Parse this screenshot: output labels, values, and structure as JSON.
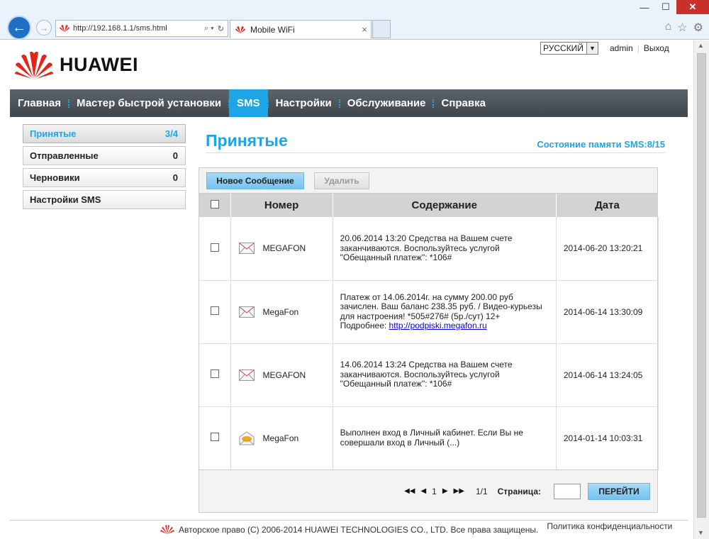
{
  "browser": {
    "url": "http://192.168.1.1/sms.html",
    "tab_title": "Mobile WiFi",
    "min_label": "—",
    "max_label": "☐",
    "close_label": "✕",
    "back_label": "←",
    "forward_label": "→"
  },
  "header": {
    "brand": "HUAWEI",
    "language": "РУССКИЙ",
    "user": "admin",
    "logout": "Выход"
  },
  "nav": {
    "items": [
      {
        "label": "Главная"
      },
      {
        "label": "Мастер быстрой установки"
      },
      {
        "label": "SMS"
      },
      {
        "label": "Настройки"
      },
      {
        "label": "Обслуживание"
      },
      {
        "label": "Справка"
      }
    ],
    "active": "SMS"
  },
  "sidebar": {
    "items": [
      {
        "label": "Принятые",
        "count": "3/4"
      },
      {
        "label": "Отправленные",
        "count": "0"
      },
      {
        "label": "Черновики",
        "count": "0"
      },
      {
        "label": "Настройки SMS",
        "count": ""
      }
    ]
  },
  "main": {
    "title": "Принятые",
    "memory_status": "Состояние памяти SMS:8/15",
    "new_button": "Новое Сообщение",
    "delete_button": "Удалить",
    "columns": {
      "number": "Номер",
      "content": "Содержание",
      "date": "Дата"
    },
    "rows": [
      {
        "sender": "MEGAFON",
        "message": "20.06.2014 13:20 Средства на Вашем счете заканчиваются. Воспользуйтесь услугой \"Обещанный платеж\": *106#",
        "link": "",
        "date": "2014-06-20 13:20:21",
        "read": false
      },
      {
        "sender": "MegaFon",
        "message": "Платеж от 14.06.2014г. на сумму 200.00 руб зачислен. Ваш баланс 238.35 руб. / Видео-курьезы для настроения! *505#276# (5р./сут) 12+ Подробнее: ",
        "link": "http://podpiski.megafon.ru",
        "date": "2014-06-14 13:30:09",
        "read": false
      },
      {
        "sender": "MEGAFON",
        "message": "14.06.2014 13:24 Средства на Вашем счете заканчиваются. Воспользуйтесь услугой \"Обещанный платеж\": *106#",
        "link": "",
        "date": "2014-06-14 13:24:05",
        "read": false
      },
      {
        "sender": "MegaFon",
        "message": "Выполнен вход в Личный кабинет. Если Вы не совершали вход в Личный (...)",
        "link": "",
        "date": "2014-01-14 10:03:31",
        "read": true
      }
    ]
  },
  "pager": {
    "current": "1",
    "total": "1/1",
    "label": "Страница:",
    "go": "ПЕРЕЙТИ"
  },
  "footer": {
    "copyright": "Авторское право (C) 2006-2014 HUAWEI TECHNOLOGIES CO., LTD. Все права защищены.",
    "privacy": "Политика конфиденциальности"
  },
  "colors": {
    "accent": "#1da5e6",
    "nav_bg": "#4a5258"
  }
}
